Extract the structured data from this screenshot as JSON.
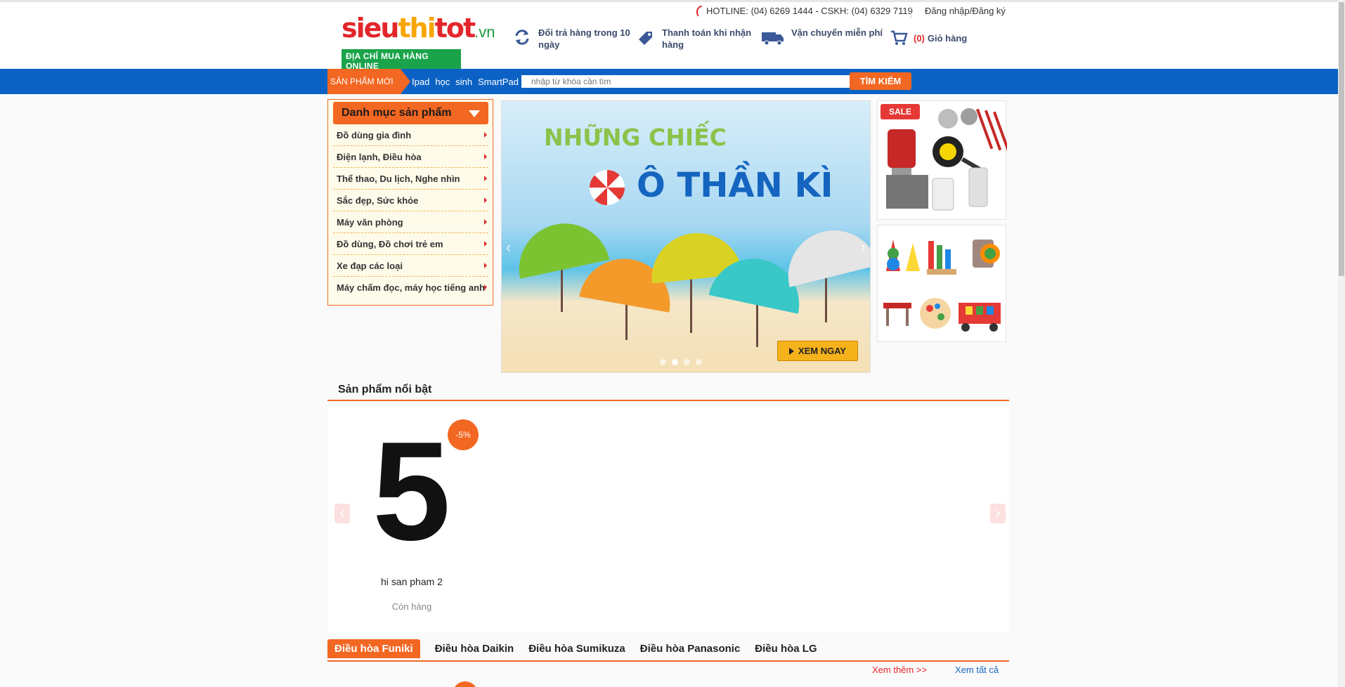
{
  "header": {
    "logo": {
      "part1": "sieu",
      "part2": "thi",
      "part3": "tot",
      "suffix": ".vn",
      "tagline": "ĐỊA CHỈ MUA HÀNG ONLINE"
    },
    "hotline": "HOTLINE: (04) 6269 1444 - CSKH: (04) 6329 7119",
    "login": "Đăng nhập/Đăng ký",
    "features": [
      {
        "icon": "refresh-icon",
        "text": "Đổi trả hàng trong 10 ngày"
      },
      {
        "icon": "payment-tag-icon",
        "text": "Thanh toán khi nhận hàng"
      },
      {
        "icon": "delivery-truck-icon",
        "text": "Vận chuyển miễn phí"
      }
    ],
    "cart": {
      "count": "(0)",
      "label": "Giỏ hàng"
    }
  },
  "nav": {
    "new_products": "SẢN PHẨM MỚI",
    "links": [
      "Ipad",
      "học",
      "sinh",
      "SmartPad"
    ],
    "search_placeholder": "nhập từ khóa cần tìm",
    "search_button": "TÌM KIẾM"
  },
  "categories": {
    "title": "Danh mục sản phẩm",
    "items": [
      "Đồ dùng gia đình",
      "Điện lạnh, Điều hòa",
      "Thể thao, Du lịch, Nghe nhìn",
      "Sắc đẹp, Sức khỏe",
      "Máy văn phòng",
      "Đồ dùng, Đồ chơi trẻ em",
      "Xe đạp các loại",
      "Máy chấm đọc, máy học tiếng anh"
    ]
  },
  "banner": {
    "line1": "NHỮNG CHIẾC",
    "line2": "Ô THẦN KÌ",
    "cta": "XEM NGAY"
  },
  "side_banner": {
    "sale_badge": "SALE"
  },
  "featured": {
    "title": "Sản phẩm nổi bật",
    "product": {
      "image_text": "5",
      "discount": "-5%",
      "name": "hi san pham 2",
      "status": "Còn hàng"
    }
  },
  "tabs": {
    "items": [
      "Điều hòa Funiki",
      "Điều hòa Daikin",
      "Điều hòa Sumikuza",
      "Điều hòa Panasonic",
      "Điều hòa LG"
    ],
    "more": "Xem thêm >>",
    "all": "Xem tất cả"
  },
  "colors": {
    "brand_orange": "#f26722",
    "nav_blue": "#0b62c4",
    "red": "#e3262b",
    "green": "#1aa34a"
  }
}
